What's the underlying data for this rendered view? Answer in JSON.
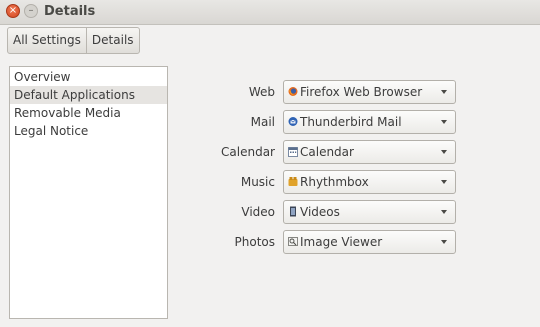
{
  "window": {
    "title": "Details"
  },
  "titlebar": {
    "close_glyph": "×",
    "minimize_glyph": "–"
  },
  "breadcrumb": {
    "items": [
      "All Settings",
      "Details"
    ]
  },
  "sidebar": {
    "items": [
      {
        "label": "Overview",
        "selected": false
      },
      {
        "label": "Default Applications",
        "selected": true
      },
      {
        "label": "Removable Media",
        "selected": false
      },
      {
        "label": "Legal Notice",
        "selected": false
      }
    ]
  },
  "defaults": [
    {
      "label": "Web",
      "value": "Firefox Web Browser",
      "icon": "firefox-icon"
    },
    {
      "label": "Mail",
      "value": "Thunderbird Mail",
      "icon": "thunderbird-icon"
    },
    {
      "label": "Calendar",
      "value": "Calendar",
      "icon": "calendar-icon"
    },
    {
      "label": "Music",
      "value": "Rhythmbox",
      "icon": "rhythmbox-icon"
    },
    {
      "label": "Video",
      "value": "Videos",
      "icon": "videos-icon"
    },
    {
      "label": "Photos",
      "value": "Image Viewer",
      "icon": "image-viewer-icon"
    }
  ]
}
